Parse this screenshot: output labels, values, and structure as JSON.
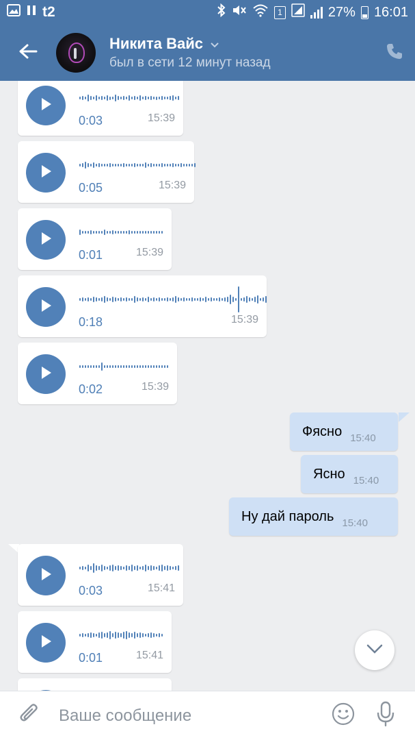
{
  "status_bar": {
    "carrier": "t2",
    "sim_slot": "1",
    "battery_percent": "27%",
    "clock": "16:01",
    "icons": [
      "gallery-icon",
      "pause-icon",
      "bluetooth-icon",
      "mute-icon",
      "wifi-icon",
      "signal-icon",
      "battery-icon"
    ]
  },
  "header": {
    "contact_name": "Никита Вайс",
    "status": "был в сети 12 минут назад",
    "background_color": "#4a76a8"
  },
  "messages": [
    {
      "type": "voice",
      "direction": "in",
      "duration": "0:03",
      "time": "15:39"
    },
    {
      "type": "voice",
      "direction": "in",
      "duration": "0:05",
      "time": "15:39"
    },
    {
      "type": "voice",
      "direction": "in",
      "duration": "0:01",
      "time": "15:39"
    },
    {
      "type": "voice",
      "direction": "in",
      "duration": "0:18",
      "time": "15:39"
    },
    {
      "type": "voice",
      "direction": "in",
      "duration": "0:02",
      "time": "15:39"
    },
    {
      "type": "text",
      "direction": "out",
      "text": "Фясно",
      "time": "15:40"
    },
    {
      "type": "text",
      "direction": "out",
      "text": "Ясно",
      "time": "15:40"
    },
    {
      "type": "text",
      "direction": "out",
      "text": "Ну дай пароль",
      "time": "15:40"
    },
    {
      "type": "voice",
      "direction": "in",
      "duration": "0:03",
      "time": "15:41"
    },
    {
      "type": "voice",
      "direction": "in",
      "duration": "0:01",
      "time": "15:41"
    }
  ],
  "composer": {
    "placeholder": "Ваше сообщение"
  },
  "colors": {
    "accent": "#5181b8",
    "outgoing_bubble": "#cfe0f5",
    "chat_background": "#edeef0"
  }
}
